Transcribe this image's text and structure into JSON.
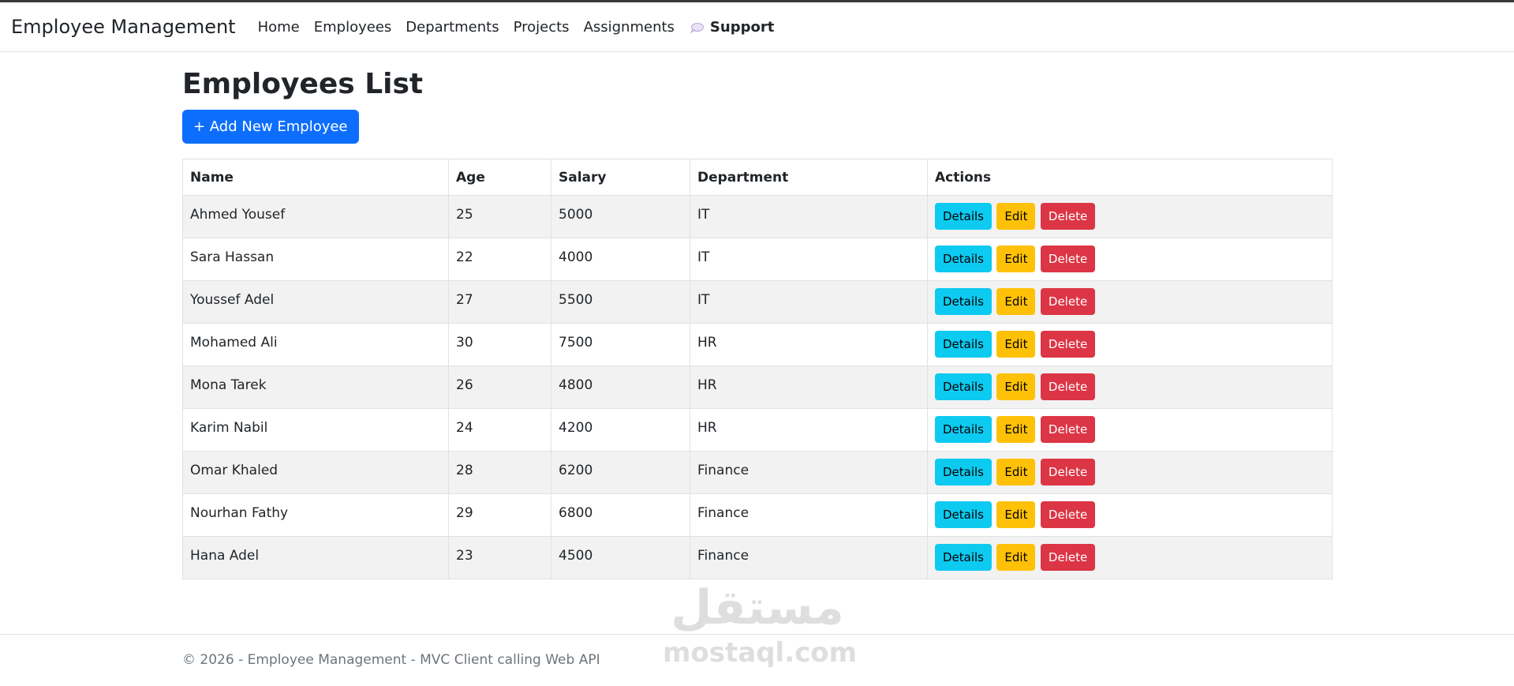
{
  "nav": {
    "brand": "Employee Management",
    "links": [
      "Home",
      "Employees",
      "Departments",
      "Projects",
      "Assignments"
    ],
    "support_label": "Support"
  },
  "main": {
    "title": "Employees List",
    "add_button": "+ Add New Employee",
    "table": {
      "headers": [
        "Name",
        "Age",
        "Salary",
        "Department",
        "Actions"
      ],
      "rows": [
        {
          "name": "Ahmed Yousef",
          "age": "25",
          "salary": "5000",
          "department": "IT"
        },
        {
          "name": "Sara Hassan",
          "age": "22",
          "salary": "4000",
          "department": "IT"
        },
        {
          "name": "Youssef Adel",
          "age": "27",
          "salary": "5500",
          "department": "IT"
        },
        {
          "name": "Mohamed Ali",
          "age": "30",
          "salary": "7500",
          "department": "HR"
        },
        {
          "name": "Mona Tarek",
          "age": "26",
          "salary": "4800",
          "department": "HR"
        },
        {
          "name": "Karim Nabil",
          "age": "24",
          "salary": "4200",
          "department": "HR"
        },
        {
          "name": "Omar Khaled",
          "age": "28",
          "salary": "6200",
          "department": "Finance"
        },
        {
          "name": "Nourhan Fathy",
          "age": "29",
          "salary": "6800",
          "department": "Finance"
        },
        {
          "name": "Hana Adel",
          "age": "23",
          "salary": "4500",
          "department": "Finance"
        }
      ],
      "actions": {
        "details": "Details",
        "edit": "Edit",
        "delete": "Delete"
      }
    }
  },
  "footer": {
    "text": "© 2026 - Employee Management - MVC Client calling Web API"
  },
  "watermark": {
    "arabic": "مستقل",
    "latin": "mostaql.com"
  },
  "colors": {
    "primary": "#0d6efd",
    "info": "#0dcaf0",
    "warning": "#ffc107",
    "danger": "#dc3545"
  },
  "icons": {
    "support": "speech-bubble-icon"
  }
}
